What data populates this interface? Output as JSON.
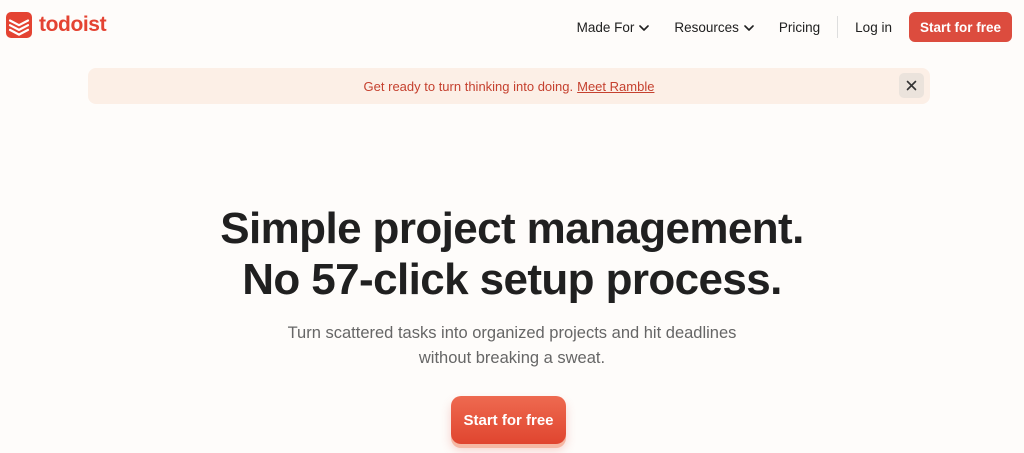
{
  "brand": {
    "name": "todoist",
    "color": "#e44332"
  },
  "nav": {
    "made_for": "Made For",
    "resources": "Resources",
    "pricing": "Pricing",
    "login": "Log in",
    "cta": "Start for free"
  },
  "banner": {
    "text": "Get ready to turn thinking into doing.",
    "link": "Meet Ramble",
    "close_icon": "close-icon"
  },
  "hero": {
    "title_line1": "Simple project management.",
    "title_line2": "No 57-click setup process.",
    "subtitle_line1": "Turn scattered tasks into organized projects and hit deadlines",
    "subtitle_line2": "without breaking a sweat.",
    "cta": "Start for free"
  },
  "colors": {
    "accent": "#dc4c3e",
    "banner_bg": "#fcefe6",
    "page_bg": "#fefcfa"
  }
}
